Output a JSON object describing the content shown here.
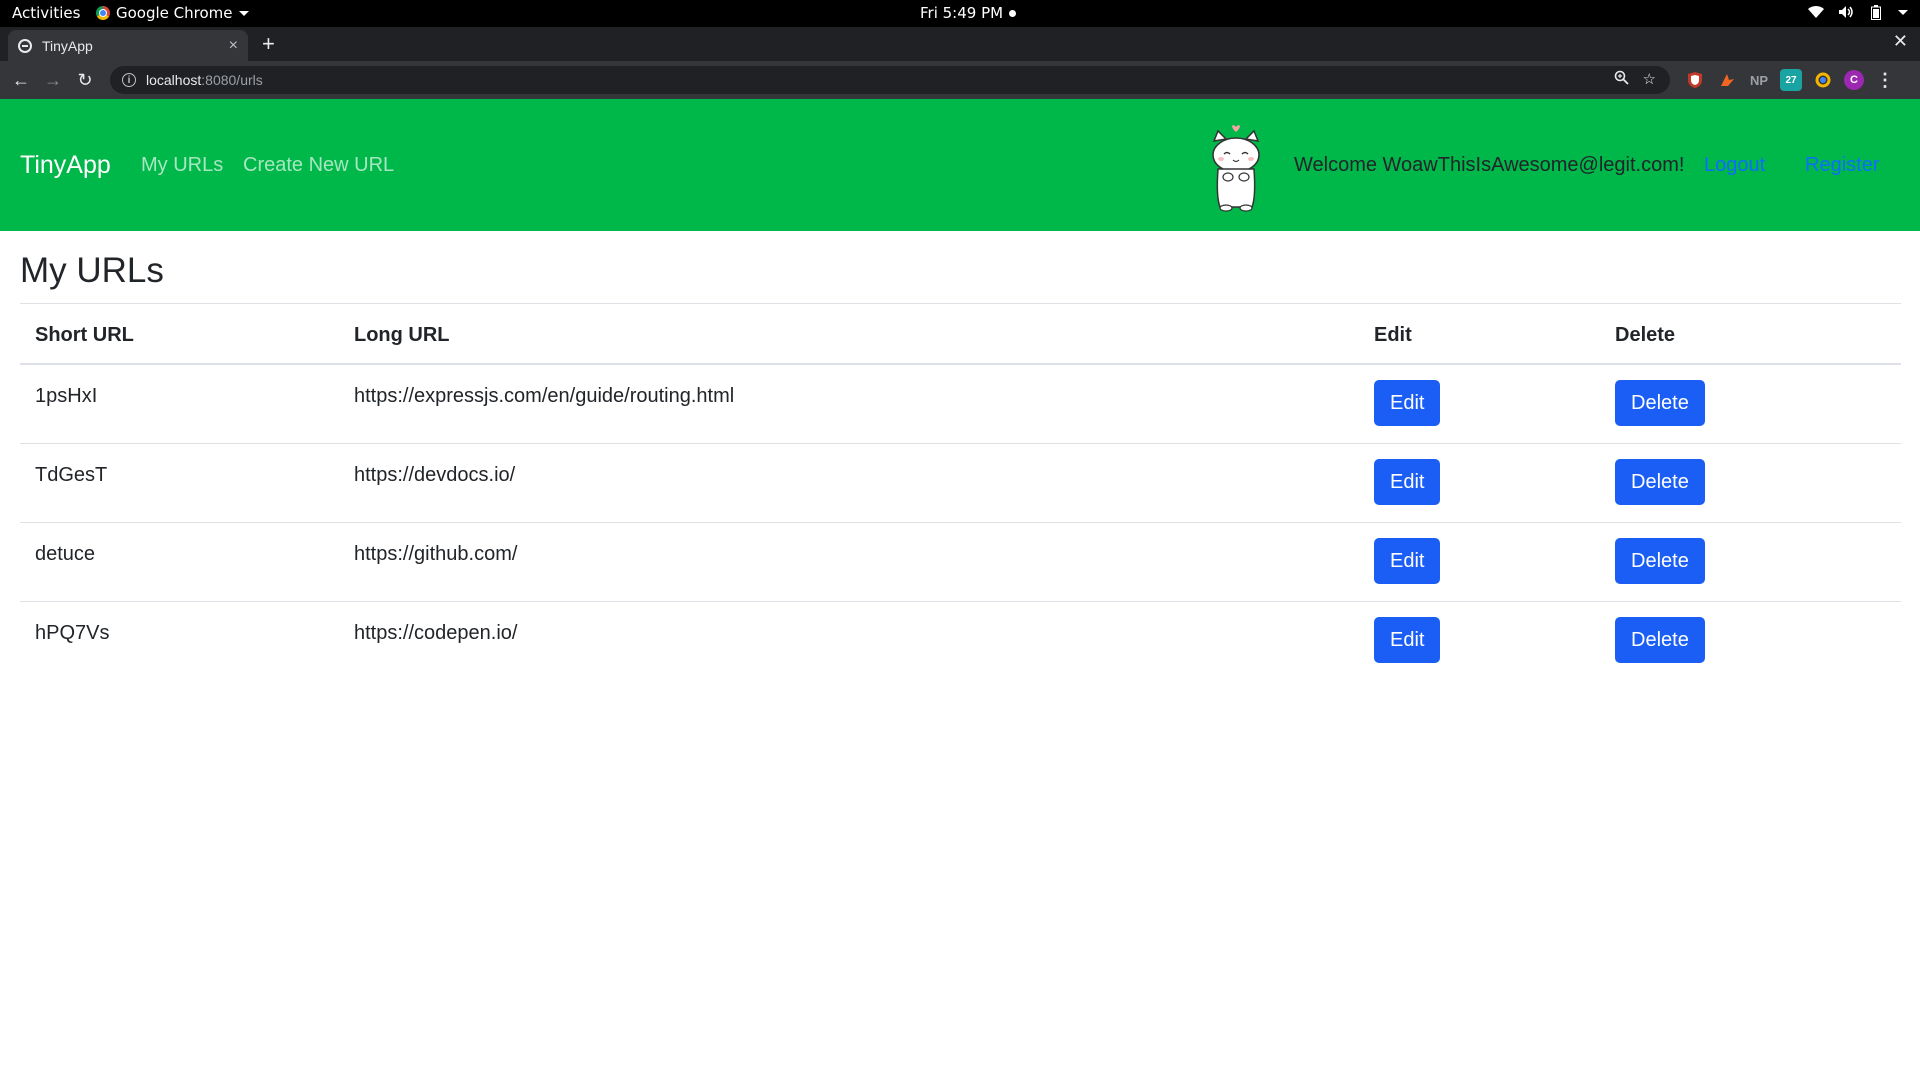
{
  "os_bar": {
    "activities": "Activities",
    "app_name": "Google Chrome",
    "clock": "Fri  5:49 PM"
  },
  "browser": {
    "tab_title": "TinyApp",
    "new_tab": "+",
    "close_tab": "×",
    "close_window": "✕",
    "url_host": "localhost",
    "url_path": ":8080/urls",
    "ext_np": "NP",
    "ext_calendar": "27",
    "profile_initial": "C"
  },
  "navbar": {
    "brand": "TinyApp",
    "my_urls": "My URLs",
    "create_new_url": "Create New URL",
    "welcome": "Welcome WoawThisIsAwesome@legit.com!",
    "logout": "Logout",
    "register": "Register",
    "bg_color": "#00b74a",
    "link_color": "#0d6efd"
  },
  "main": {
    "title": "My URLs",
    "headers": {
      "short": "Short URL",
      "long": "Long URL",
      "edit": "Edit",
      "delete": "Delete"
    },
    "rows": [
      {
        "short": "1psHxI",
        "long": "https://expressjs.com/en/guide/routing.html",
        "edit": "Edit",
        "delete": "Delete"
      },
      {
        "short": "TdGesT",
        "long": "https://devdocs.io/",
        "edit": "Edit",
        "delete": "Delete"
      },
      {
        "short": "detuce",
        "long": "https://github.com/",
        "edit": "Edit",
        "delete": "Delete"
      },
      {
        "short": "hPQ7Vs",
        "long": "https://codepen.io/",
        "edit": "Edit",
        "delete": "Delete"
      }
    ],
    "button_color": "#1a5ef5"
  }
}
